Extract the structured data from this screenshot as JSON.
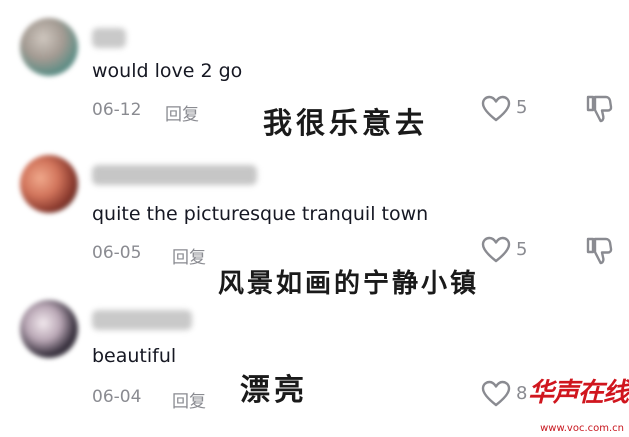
{
  "comments": [
    {
      "text": "would love 2 go",
      "date": "06-12",
      "reply_label": "回复",
      "likes": "5",
      "caption": "我很乐意去"
    },
    {
      "text": "quite the picturesque tranquil town",
      "date": "06-05",
      "reply_label": "回复",
      "likes": "5",
      "caption": "风景如画的宁静小镇"
    },
    {
      "text": "beautiful",
      "date": "06-04",
      "reply_label": "回复",
      "likes": "8",
      "caption": "漂亮"
    }
  ],
  "watermark": {
    "logo_text": "华声在线",
    "url": "www.voc.com.cn"
  },
  "colors": {
    "text": "#161823",
    "meta": "#8a8b91",
    "caption": "#1a1a1a",
    "watermark": "#d0161e"
  },
  "icons": {
    "like": "heart-icon",
    "dislike": "thumbs-down-icon"
  }
}
